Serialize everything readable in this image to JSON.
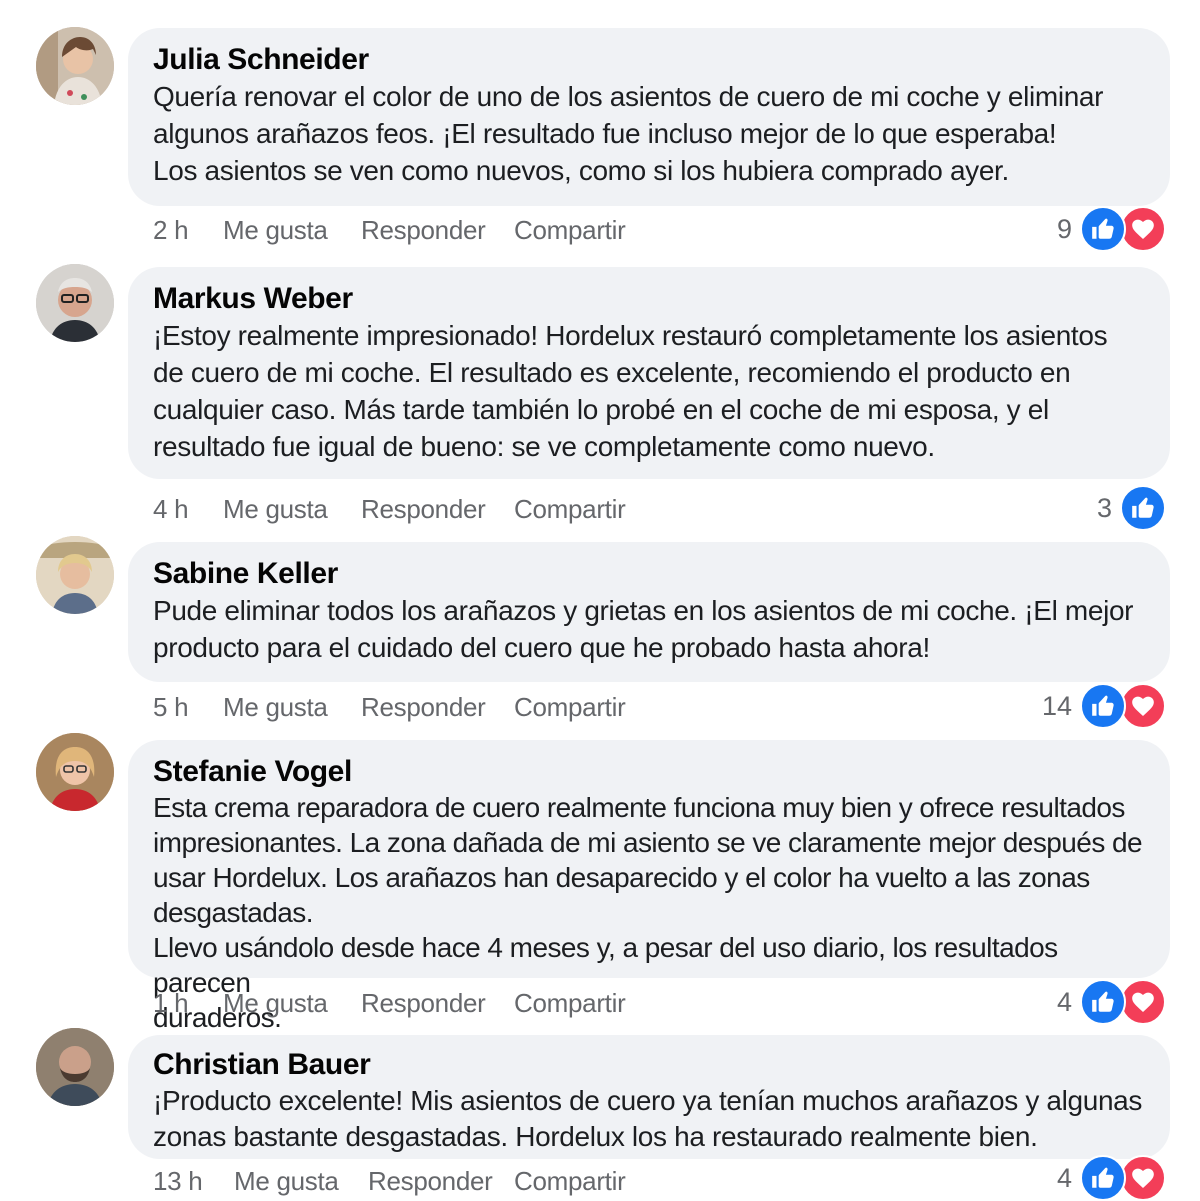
{
  "actions": {
    "like_label": "Me gusta",
    "reply_label": "Responder",
    "share_label": "Compartir"
  },
  "colors": {
    "bubble": "#f0f2f5",
    "like_reaction": "#1877f2",
    "love_reaction": "#f33e58",
    "secondary_text": "#65676b"
  },
  "comments": [
    {
      "author": "Julia Schneider",
      "text": "Quería renovar el color de uno de los asientos de cuero de mi coche y eliminar\nalgunos arañazos feos. ¡El resultado fue incluso mejor de lo que esperaba!\nLos asientos se ven como nuevos, como si los hubiera comprado ayer.",
      "time": "2 h",
      "reaction_count": "9",
      "reactions": [
        "like-icon",
        "love-icon"
      ]
    },
    {
      "author": "Markus Weber",
      "text": "¡Estoy realmente impresionado! Hordelux restauró completamente los asientos\nde cuero de mi coche. El resultado es excelente, recomiendo el producto en\ncualquier caso. Más tarde también lo probé en el coche de mi esposa, y el\nresultado fue igual de bueno: se ve completamente como nuevo.",
      "time": "4 h",
      "reaction_count": "3",
      "reactions": [
        "like-icon"
      ]
    },
    {
      "author": "Sabine Keller",
      "text": "Pude eliminar todos los arañazos y grietas en los asientos de mi coche. ¡El mejor\nproducto para el cuidado del cuero que he probado hasta ahora!",
      "time": "5 h",
      "reaction_count": "14",
      "reactions": [
        "like-icon",
        "love-icon"
      ]
    },
    {
      "author": "Stefanie Vogel",
      "text": "Esta crema reparadora de cuero realmente funciona muy bien y ofrece resultados\nimpresionantes. La zona dañada de mi asiento se ve claramente mejor después de\nusar Hordelux. Los arañazos han desaparecido y el color ha vuelto a las zonas desgastadas.\nLlevo usándolo desde hace 4 meses y, a pesar del uso diario, los resultados parecen\nduraderos.",
      "time": "1 h",
      "reaction_count": "4",
      "reactions": [
        "like-icon",
        "love-icon"
      ]
    },
    {
      "author": "Christian Bauer",
      "text": "¡Producto excelente! Mis asientos de cuero ya tenían muchos arañazos y algunas\nzonas bastante desgastadas. Hordelux los ha restaurado realmente bien.",
      "time": "13 h",
      "reaction_count": "4",
      "reactions": [
        "like-icon",
        "love-icon"
      ]
    }
  ]
}
